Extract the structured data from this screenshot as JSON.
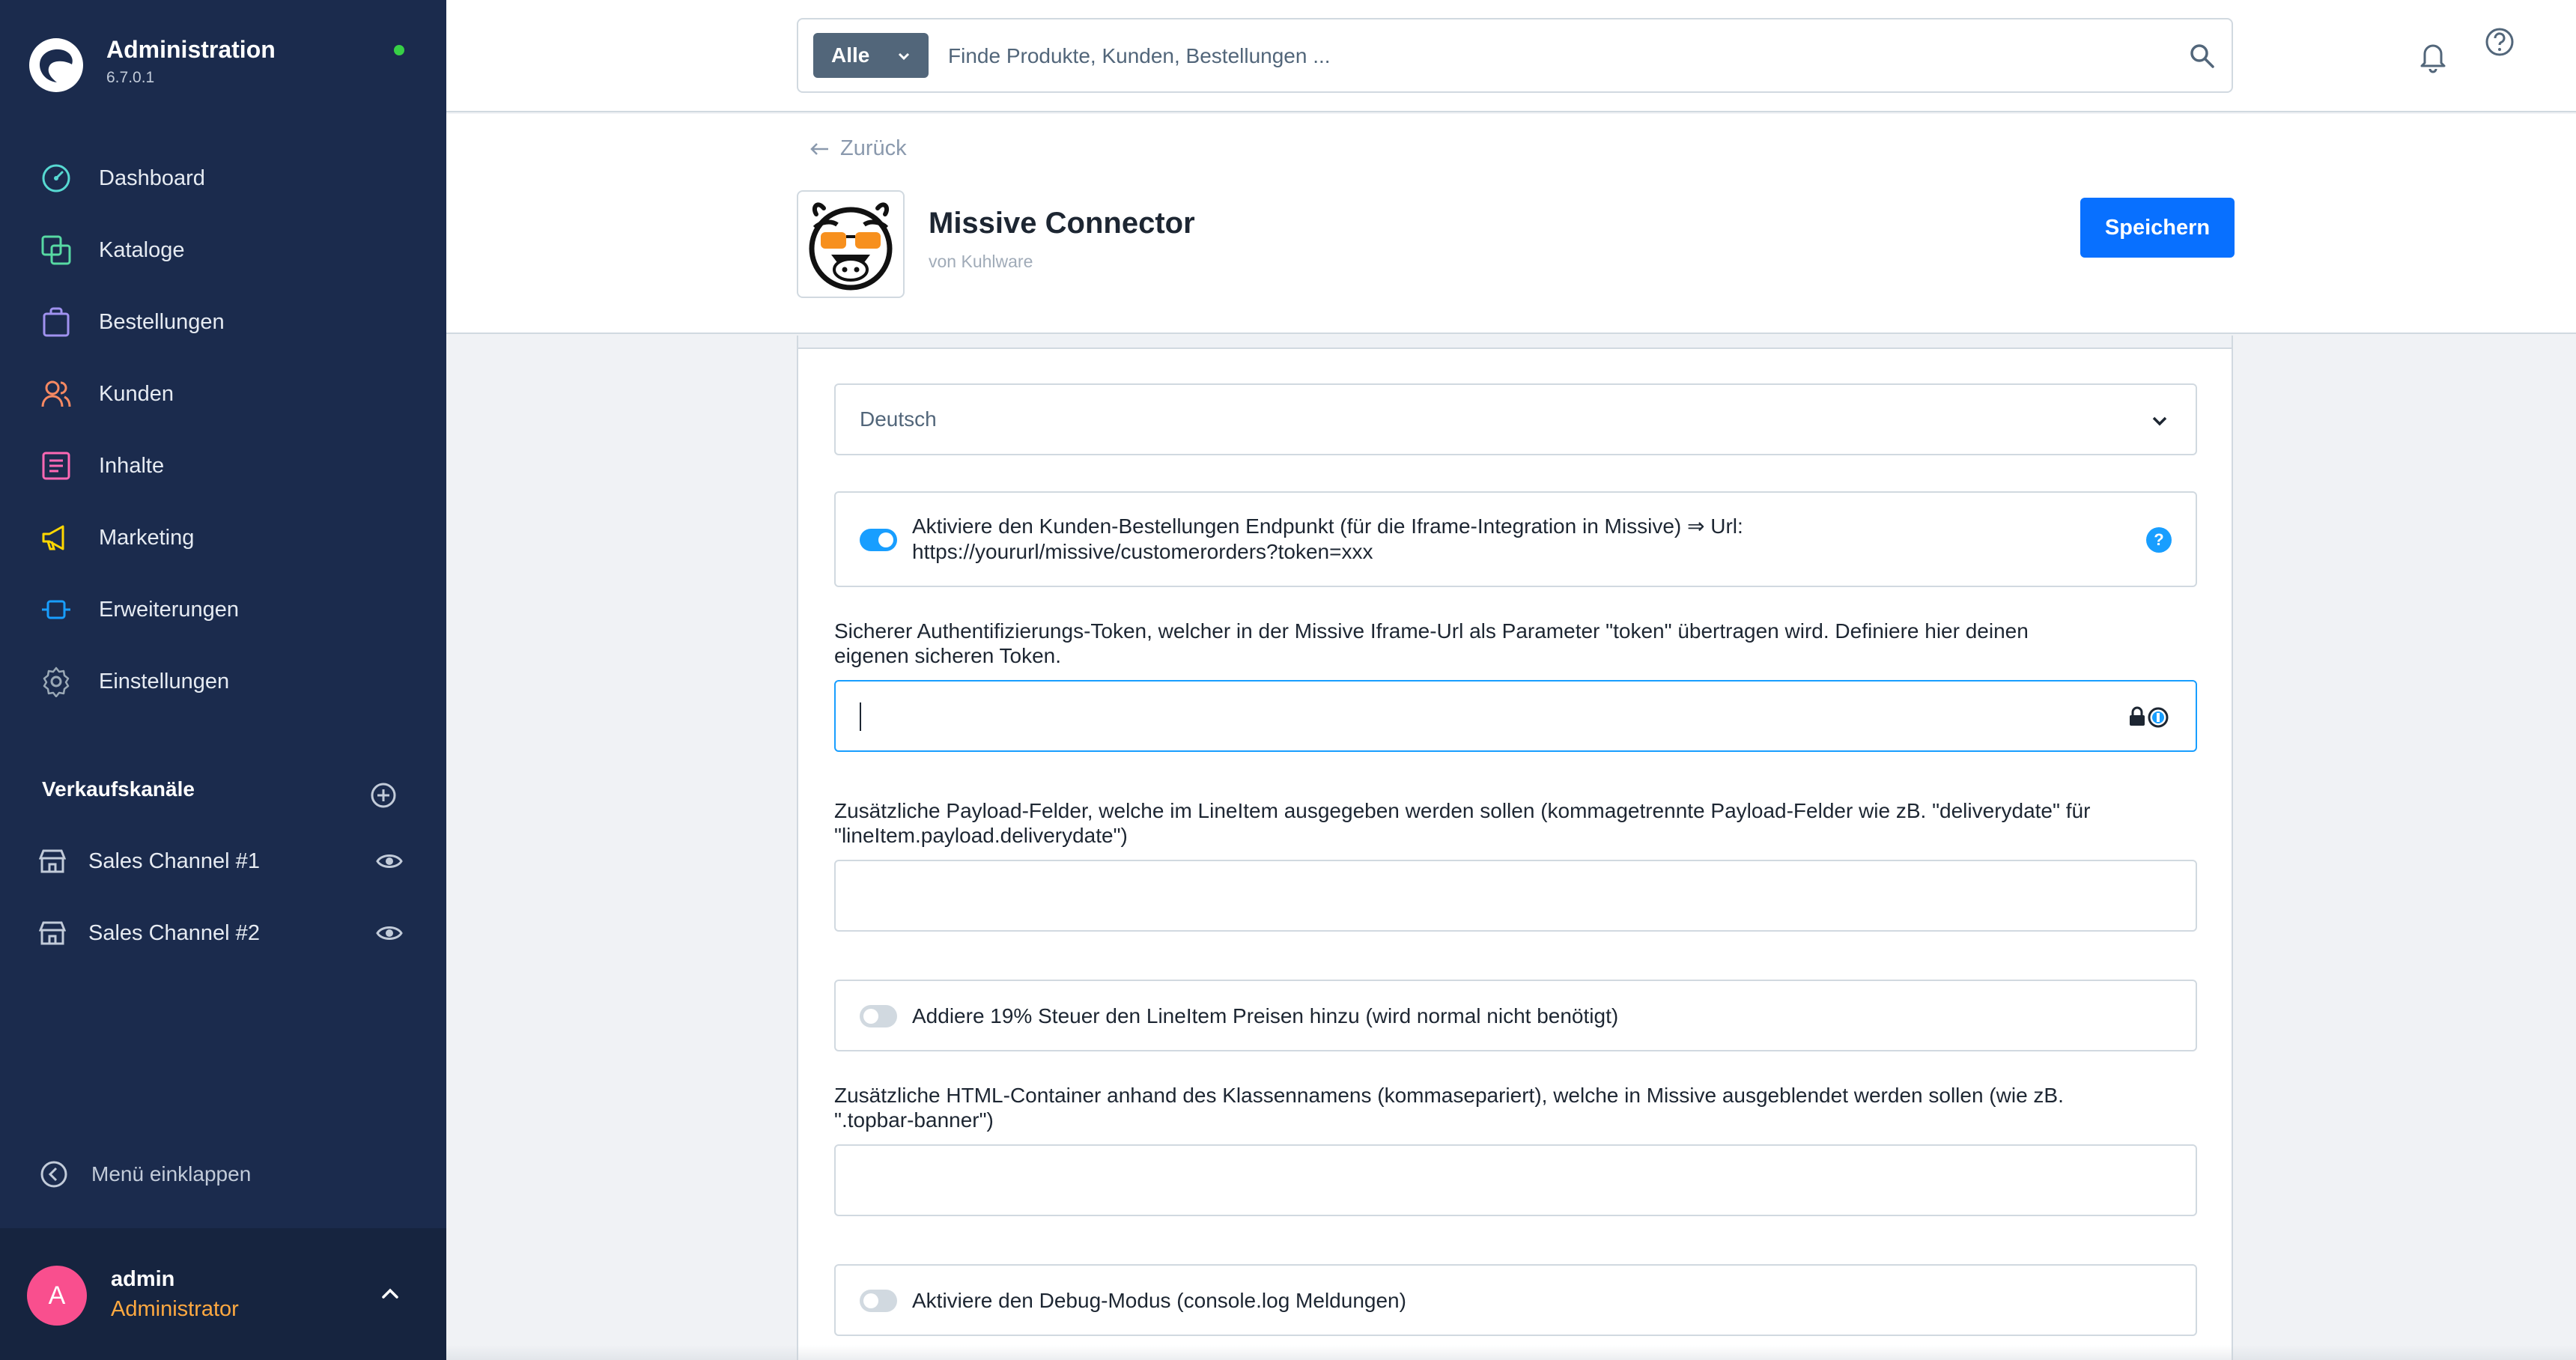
{
  "app": {
    "title": "Administration",
    "version": "6.7.0.1",
    "status_color": "#37d046"
  },
  "nav": {
    "items": [
      {
        "label": "Dashboard",
        "icon": "dashboard-icon",
        "color": "#57d9d2"
      },
      {
        "label": "Kataloge",
        "icon": "catalog-icon",
        "color": "#57d9a3"
      },
      {
        "label": "Bestellungen",
        "icon": "orders-icon",
        "color": "#a092f0"
      },
      {
        "label": "Kunden",
        "icon": "customers-icon",
        "color": "#f88962"
      },
      {
        "label": "Inhalte",
        "icon": "content-icon",
        "color": "#ff68b4"
      },
      {
        "label": "Marketing",
        "icon": "marketing-icon",
        "color": "#ffd700"
      },
      {
        "label": "Erweiterungen",
        "icon": "extensions-icon",
        "color": "#189eff"
      },
      {
        "label": "Einstellungen",
        "icon": "settings-icon",
        "color": "#9aa8b5"
      }
    ]
  },
  "sales_channels": {
    "heading": "Verkaufskanäle",
    "items": [
      {
        "label": "Sales Channel #1"
      },
      {
        "label": "Sales Channel #2"
      }
    ]
  },
  "collapse_label": "Menü einklappen",
  "user": {
    "initial": "A",
    "name": "admin",
    "role": "Administrator"
  },
  "search": {
    "type": "Alle",
    "placeholder": "Finde Produkte, Kunden, Bestellungen ..."
  },
  "header": {
    "back": "Zurück",
    "plugin_name": "Missive Connector",
    "vendor": "von Kuhlware",
    "save": "Speichern"
  },
  "config": {
    "language": "Deutsch",
    "customer_orders_toggle": {
      "label_line1": "Aktiviere den Kunden-Bestellungen Endpunkt (für die Iframe-Integration in Missive) ⇒ Url:",
      "label_line2": "https://yoururl/missive/customerorders?token=xxx",
      "checked": true
    },
    "token_label_line1": "Sicherer Authentifizierungs-Token, welcher in der Missive Iframe-Url als Parameter \"token\" übertragen wird. Definiere hier deinen",
    "token_label_line2": "eigenen sicheren Token.",
    "token_value": "",
    "payload_label_line1": "Zusätzliche Payload-Felder, welche im LineItem ausgegeben werden sollen (kommagetrennte Payload-Felder wie zB. \"deliverydate\" für",
    "payload_label_line2": "\"lineItem.payload.deliverydate\")",
    "payload_value": "",
    "tax_toggle": {
      "label": "Addiere 19% Steuer den LineItem Preisen hinzu (wird normal nicht benötigt)",
      "checked": false
    },
    "html_label_line1": "Zusätzliche HTML-Container anhand des Klassennamens (kommasepariert), welche in Missive ausgeblendet werden sollen (wie zB.",
    "html_label_line2": "\".topbar-banner\")",
    "html_value": "",
    "debug_toggle": {
      "label": "Aktiviere den Debug-Modus (console.log Meldungen)",
      "checked": false
    }
  },
  "colors": {
    "sidebar": "#1b2b4d",
    "primary": "#0870ff",
    "toggle_on": "#189eff",
    "avatar": "#f94f8e",
    "role": "#ffa940"
  }
}
